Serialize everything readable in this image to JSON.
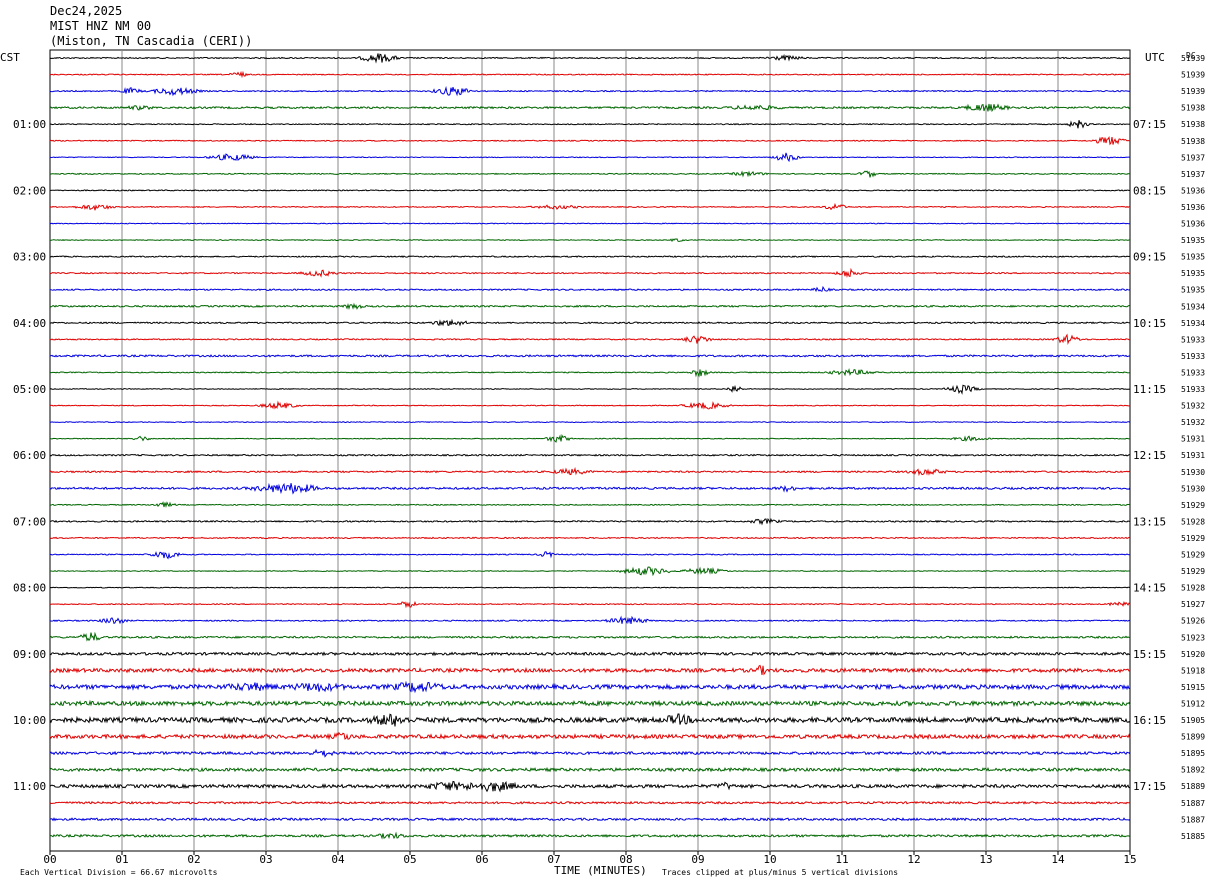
{
  "header": {
    "date": "Dec24,2025",
    "station": "MIST HNZ NM 00",
    "location": "(Miston, TN Cascadia (CERI))"
  },
  "chart_data": {
    "type": "line",
    "description_kind": "seismogram helicorder",
    "left_axis_label": "CST",
    "right_axis_label": "UTC",
    "dc_label": "DC",
    "xlabel": "TIME (MINUTES)",
    "x_ticks": [
      "00",
      "01",
      "02",
      "03",
      "04",
      "05",
      "06",
      "07",
      "08",
      "09",
      "10",
      "11",
      "12",
      "13",
      "14",
      "15"
    ],
    "xlim": [
      0,
      15
    ],
    "left_hour_labels": [
      "01:00",
      "02:00",
      "03:00",
      "04:00",
      "05:00",
      "06:00",
      "07:00",
      "08:00",
      "09:00",
      "10:00",
      "11:00"
    ],
    "right_hour_labels": [
      "07:15",
      "08:15",
      "09:15",
      "10:15",
      "11:15",
      "12:15",
      "13:15",
      "14:15",
      "15:15",
      "16:15",
      "17:15"
    ],
    "trace_colors": [
      "#000000",
      "#e00000",
      "#0000e0",
      "#006600"
    ],
    "dc_values": [
      "51939",
      "51939",
      "51939",
      "51938",
      "51938",
      "51938",
      "51937",
      "51937",
      "51936",
      "51936",
      "51936",
      "51935",
      "51935",
      "51935",
      "51935",
      "51934",
      "51934",
      "51933",
      "51933",
      "51933",
      "51933",
      "51932",
      "51932",
      "51931",
      "51931",
      "51930",
      "51930",
      "51929",
      "51928",
      "51929",
      "51929",
      "51929",
      "51928",
      "51927",
      "51926",
      "51923",
      "51920",
      "51918",
      "51915",
      "51912",
      "51905",
      "51899",
      "51895",
      "51892",
      "51889",
      "51887",
      "51887",
      "51885"
    ],
    "trace_amplitude": [
      0.6,
      0.5,
      0.6,
      0.9,
      0.5,
      0.5,
      0.4,
      0.5,
      0.5,
      0.5,
      0.4,
      0.4,
      0.6,
      0.6,
      0.7,
      0.8,
      0.7,
      0.6,
      0.9,
      0.5,
      0.4,
      0.4,
      0.4,
      0.4,
      0.7,
      0.8,
      1.0,
      0.5,
      0.7,
      0.6,
      0.5,
      0.4,
      0.4,
      0.5,
      0.6,
      0.9,
      1.3,
      1.8,
      2.1,
      2.1,
      2.4,
      1.9,
      1.3,
      1.5,
      1.6,
      1.0,
      1.1,
      1.1
    ],
    "footer_left": "Each Vertical Division =   66.67 microvolts",
    "footer_right": "Traces clipped at plus/minus 5 vertical divisions"
  }
}
